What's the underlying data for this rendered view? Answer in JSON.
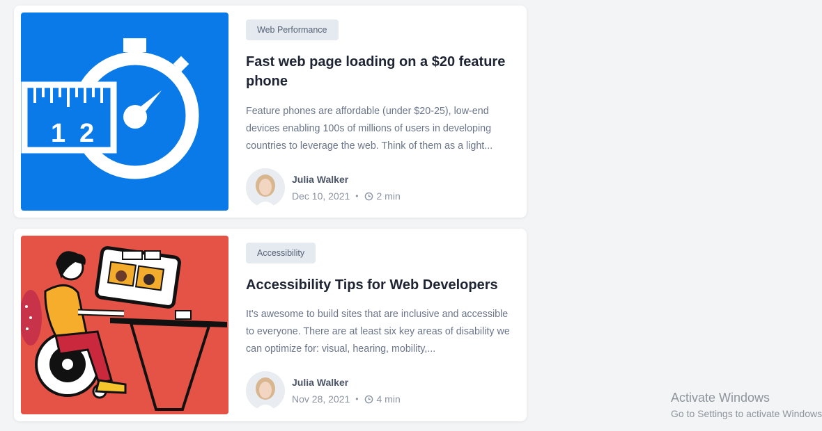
{
  "posts": [
    {
      "tag": "Web Performance",
      "title": "Fast web page loading on a $20 feature phone",
      "excerpt": "Feature phones are affordable (under $20-25), low-end devices enabling 100s of millions of users in developing countries to leverage the web. Think of them as a light...",
      "author": "Julia Walker",
      "date": "Dec 10, 2021",
      "read_time": "2 min",
      "thumbnail_icon": "stopwatch-ruler-illustration",
      "thumbnail_color": "#0a7ae8"
    },
    {
      "tag": "Accessibility",
      "title": "Accessibility Tips for Web Developers",
      "excerpt": "It's awesome to build sites that are inclusive and accessible to everyone. There are at least six key areas of disability we can optimize for: visual, hearing, mobility,...",
      "author": "Julia Walker",
      "date": "Nov 28, 2021",
      "read_time": "4 min",
      "thumbnail_icon": "wheelchair-user-computer-illustration",
      "thumbnail_color": "#e55346"
    }
  ],
  "watermark": {
    "title": "Activate Windows",
    "subtitle": "Go to Settings to activate Windows."
  }
}
